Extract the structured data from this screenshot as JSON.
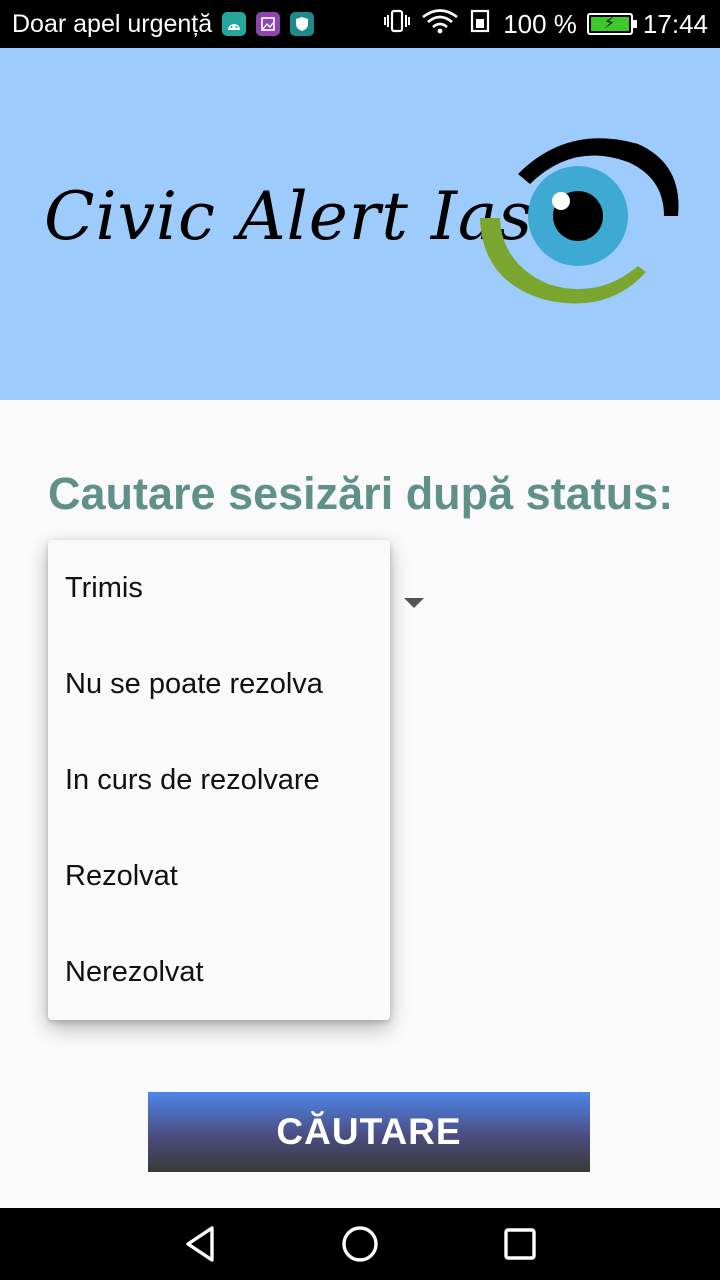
{
  "status_bar": {
    "left_text": "Doar apel urgență",
    "battery": "100 %",
    "time": "17:44",
    "notif_icons": [
      {
        "icon": "android-icon",
        "color": "#26a69a"
      },
      {
        "icon": "gallery-icon",
        "color": "#8e44ad"
      },
      {
        "icon": "shield-icon",
        "color": "#1e8a8a"
      }
    ]
  },
  "header": {
    "logo_text": "Civic Alert Iasi",
    "colors": {
      "background": "#9ccbfc",
      "eye_iris": "#3ea9d3",
      "eye_arc_green": "#7aa52f",
      "eye_arc_black": "#000000"
    }
  },
  "main": {
    "title": "Cautare sesizări după status:",
    "title_color": "#5f918a"
  },
  "dropdown": {
    "options": [
      "Trimis",
      "Nu se poate rezolva",
      "In curs de rezolvare",
      "Rezolvat",
      "Nerezolvat"
    ]
  },
  "search_button": {
    "label": "CĂUTARE"
  },
  "nav": {
    "back": "back-icon",
    "home": "home-icon",
    "recents": "recents-icon"
  }
}
